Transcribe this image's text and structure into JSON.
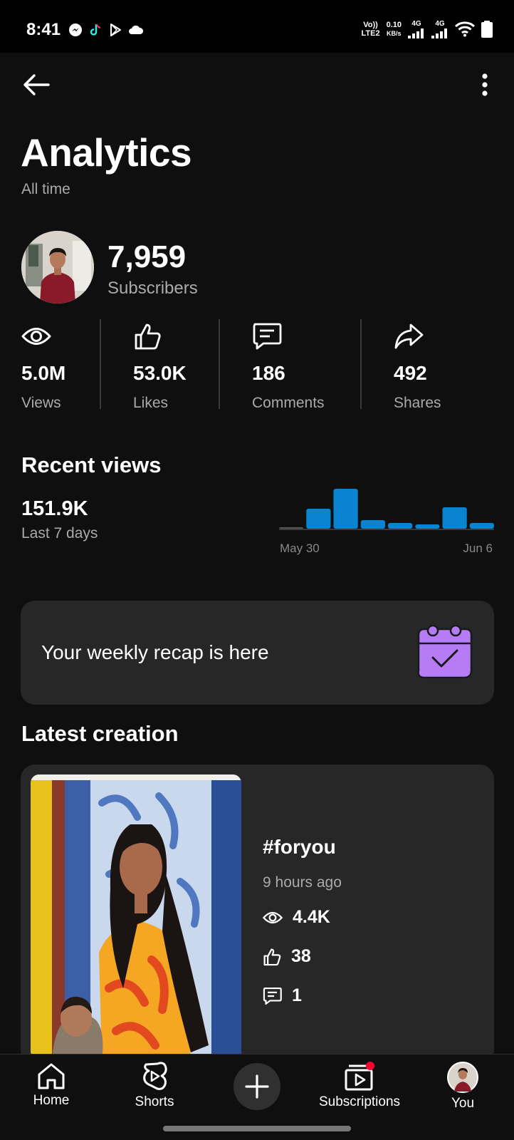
{
  "status": {
    "time": "8:41",
    "volte": "Vo))",
    "lte": "LTE2",
    "speed": "0.10",
    "speed_unit": "KB/s",
    "net1": "4G",
    "net2": "4G"
  },
  "header": {
    "title": "Analytics",
    "subtitle": "All time"
  },
  "channel": {
    "subscribers": "7,959",
    "subscribers_label": "Subscribers"
  },
  "stats": [
    {
      "icon": "eye-icon",
      "value": "5.0M",
      "label": "Views"
    },
    {
      "icon": "thumbs-up-icon",
      "value": "53.0K",
      "label": "Likes"
    },
    {
      "icon": "comment-icon",
      "value": "186",
      "label": "Comments"
    },
    {
      "icon": "share-icon",
      "value": "492",
      "label": "Shares"
    }
  ],
  "recent_views": {
    "title": "Recent views",
    "value": "151.9K",
    "period": "Last 7 days",
    "x_start": "May 30",
    "x_end": "Jun 6"
  },
  "chart_data": {
    "type": "bar",
    "title": "",
    "xlabel": "",
    "ylabel": "",
    "x_start_label": "May 30",
    "x_end_label": "Jun 6",
    "values": [
      1,
      14,
      28,
      6,
      4,
      3,
      15,
      4
    ],
    "ylim": [
      0,
      30
    ],
    "grid": false,
    "color": "#0a84d0"
  },
  "recap": {
    "text": "Your weekly recap is here",
    "icon": "calendar-check-icon",
    "icon_color": "#b57cf5"
  },
  "latest": {
    "section_title": "Latest creation",
    "video_title": "#foryou",
    "posted": "9 hours ago",
    "views": "4.4K",
    "likes": "38",
    "comments": "1"
  },
  "nav": {
    "home": "Home",
    "shorts": "Shorts",
    "subscriptions": "Subscriptions",
    "you": "You",
    "notification_color": "#ff0033"
  }
}
